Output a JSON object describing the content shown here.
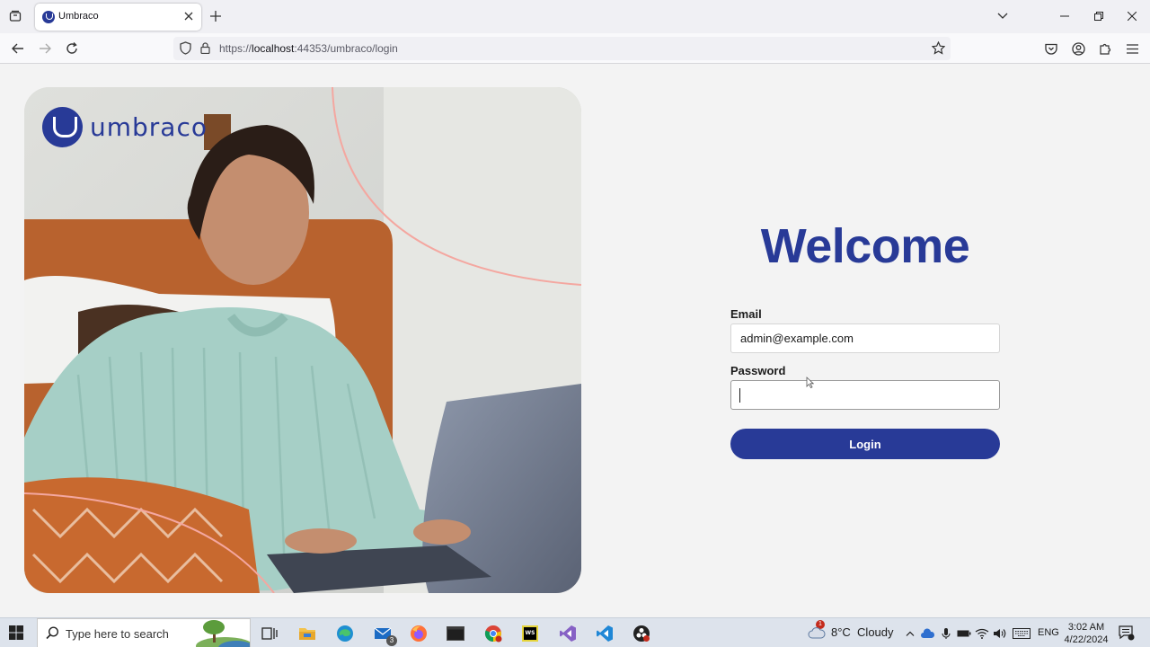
{
  "browser": {
    "tab": {
      "title": "Umbraco"
    },
    "url": {
      "scheme": "https://",
      "host": "localhost",
      "rest": ":44353/umbraco/login"
    }
  },
  "brand": {
    "name": "umbraco",
    "color": "#283a97"
  },
  "login": {
    "heading": "Welcome",
    "email_label": "Email",
    "email_value": "admin@example.com",
    "password_label": "Password",
    "password_value": "",
    "button_label": "Login"
  },
  "taskbar": {
    "search_placeholder": "Type here to search",
    "apps": [
      "task-view",
      "file-explorer",
      "edge",
      "mail",
      "firefox",
      "terminal",
      "chrome",
      "webstorm",
      "visual-studio",
      "vscode",
      "obs"
    ],
    "mail_badge": "3",
    "weather": "8°C  Cloudy",
    "weather_badge": "1",
    "language": "ENG",
    "time": "3:02 AM",
    "date": "4/22/2024"
  }
}
